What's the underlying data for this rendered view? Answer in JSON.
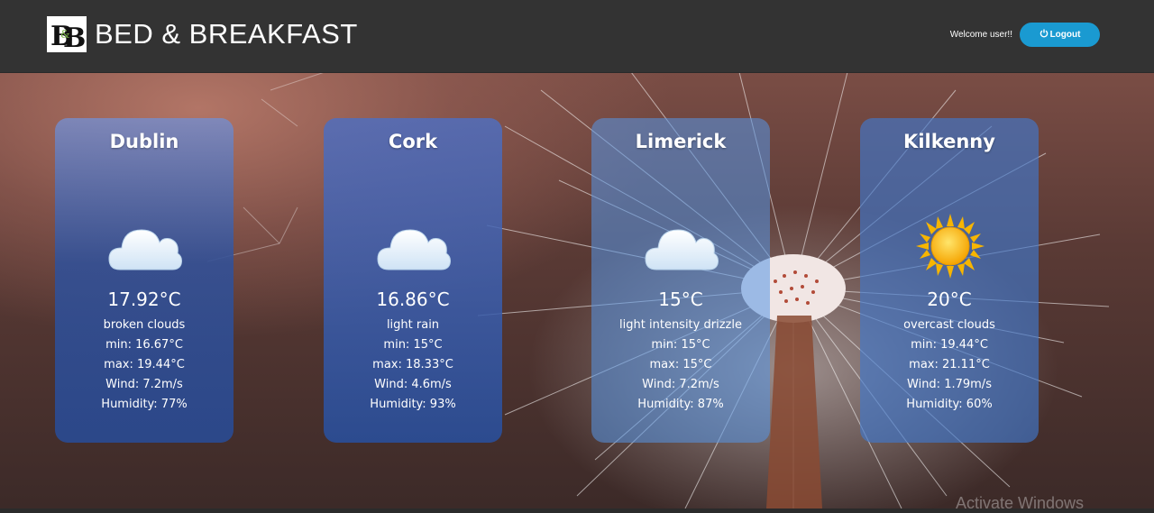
{
  "header": {
    "brand": "BED & BREAKFAST",
    "welcome": "Welcome user!!",
    "logout_label": "Logout"
  },
  "cards": [
    {
      "city": "Dublin",
      "icon": "cloud-icon",
      "temp": "17.92°C",
      "desc": "broken clouds",
      "min": "min: 16.67°C",
      "max": "max: 19.44°C",
      "wind": "Wind: 7.2m/s",
      "humidity": "Humidity: 77%"
    },
    {
      "city": "Cork",
      "icon": "cloud-icon",
      "temp": "16.86°C",
      "desc": "light rain",
      "min": "min: 15°C",
      "max": "max: 18.33°C",
      "wind": "Wind: 4.6m/s",
      "humidity": "Humidity: 93%"
    },
    {
      "city": "Limerick",
      "icon": "cloud-icon",
      "temp": "15°C",
      "desc": "light intensity drizzle",
      "min": "min: 15°C",
      "max": "max: 15°C",
      "wind": "Wind: 7.2m/s",
      "humidity": "Humidity: 87%"
    },
    {
      "city": "Kilkenny",
      "icon": "sun-icon",
      "temp": "20°C",
      "desc": "overcast clouds",
      "min": "min: 19.44°C",
      "max": "max: 21.11°C",
      "wind": "Wind: 1.79m/s",
      "humidity": "Humidity: 60%"
    }
  ],
  "watermark": "Activate Windows",
  "colors": {
    "header_bg": "#333333",
    "logout_bg": "#1a9ad1"
  }
}
